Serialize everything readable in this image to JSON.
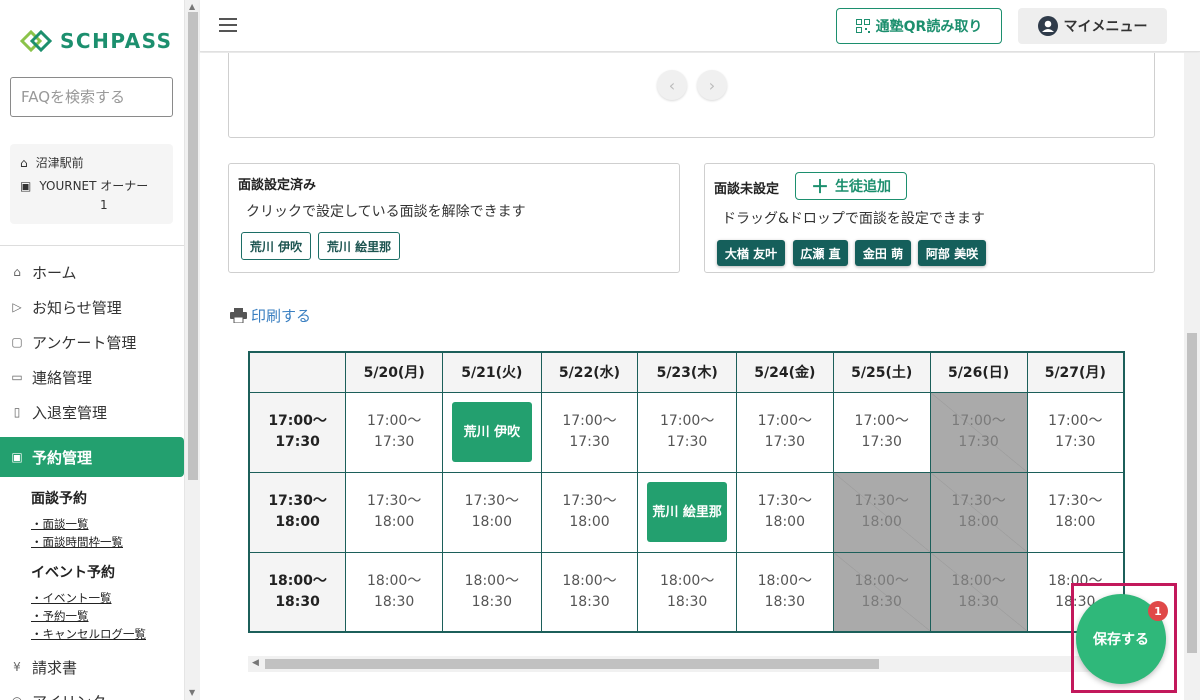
{
  "brand": {
    "name": "SCHPASS"
  },
  "search": {
    "placeholder": "FAQを検索する"
  },
  "org": {
    "school": "沼津駅前",
    "user": "YOURNET オーナー",
    "id": "1"
  },
  "sidebar": {
    "items": [
      {
        "label": "ホーム",
        "icon": "home-icon"
      },
      {
        "label": "お知らせ管理",
        "icon": "send-icon"
      },
      {
        "label": "アンケート管理",
        "icon": "survey-icon"
      },
      {
        "label": "連絡管理",
        "icon": "chat-icon"
      },
      {
        "label": "入退室管理",
        "icon": "door-icon"
      },
      {
        "label": "予約管理",
        "icon": "calendar-icon",
        "active": true
      }
    ],
    "sub": {
      "interview_heading": "面談予約",
      "interview_links": [
        "・面談一覧",
        "・面談時間枠一覧"
      ],
      "event_heading": "イベント予約",
      "event_links": [
        "・イベント一覧",
        "・予約一覧",
        "・キャンセルログ一覧"
      ]
    },
    "after": [
      {
        "label": "請求書",
        "icon": "yen-icon"
      },
      {
        "label": "アイリンク",
        "icon": "link-icon"
      }
    ]
  },
  "header": {
    "qr_label": "通塾QR読み取り",
    "mymenu_label": "マイメニュー"
  },
  "set_panel": {
    "title": "面談設定済み",
    "desc": "クリックで設定している面談を解除できます",
    "students": [
      "荒川 伊吹",
      "荒川 絵里那"
    ]
  },
  "unset_panel": {
    "title": "面談未設定",
    "add_label": "生徒追加",
    "desc": "ドラッグ&ドロップで面談を設定できます",
    "students": [
      "大楢 友叶",
      "広瀬 直",
      "金田 萌",
      "阿部 美咲"
    ]
  },
  "print_label": "印刷する",
  "calendar": {
    "dates": [
      "5/20(月)",
      "5/21(火)",
      "5/22(水)",
      "5/23(木)",
      "5/24(金)",
      "5/25(土)",
      "5/26(日)",
      "5/27(月)"
    ],
    "rows": [
      {
        "time": [
          "17:00〜",
          "17:30"
        ],
        "cells": [
          {
            "t": [
              "17:00〜",
              "17:30"
            ]
          },
          {
            "booked": "荒川 伊吹"
          },
          {
            "t": [
              "17:00〜",
              "17:30"
            ]
          },
          {
            "t": [
              "17:00〜",
              "17:30"
            ]
          },
          {
            "t": [
              "17:00〜",
              "17:30"
            ]
          },
          {
            "t": [
              "17:00〜",
              "17:30"
            ]
          },
          {
            "t": [
              "17:00〜",
              "17:30"
            ],
            "closed": true
          },
          {
            "t": [
              "17:00〜",
              "17:30"
            ]
          }
        ]
      },
      {
        "time": [
          "17:30〜",
          "18:00"
        ],
        "cells": [
          {
            "t": [
              "17:30〜",
              "18:00"
            ]
          },
          {
            "t": [
              "17:30〜",
              "18:00"
            ]
          },
          {
            "t": [
              "17:30〜",
              "18:00"
            ]
          },
          {
            "booked": "荒川 絵里那"
          },
          {
            "t": [
              "17:30〜",
              "18:00"
            ]
          },
          {
            "t": [
              "17:30〜",
              "18:00"
            ],
            "closed": true
          },
          {
            "t": [
              "17:30〜",
              "18:00"
            ],
            "closed": true
          },
          {
            "t": [
              "17:30〜",
              "18:00"
            ]
          }
        ]
      },
      {
        "time": [
          "18:00〜",
          "18:30"
        ],
        "cells": [
          {
            "t": [
              "18:00〜",
              "18:30"
            ]
          },
          {
            "t": [
              "18:00〜",
              "18:30"
            ]
          },
          {
            "t": [
              "18:00〜",
              "18:30"
            ]
          },
          {
            "t": [
              "18:00〜",
              "18:30"
            ]
          },
          {
            "t": [
              "18:00〜",
              "18:30"
            ]
          },
          {
            "t": [
              "18:00〜",
              "18:30"
            ],
            "closed": true
          },
          {
            "t": [
              "18:00〜",
              "18:30"
            ],
            "closed": true
          },
          {
            "t": [
              "18:00〜",
              "18:30"
            ]
          }
        ]
      }
    ]
  },
  "save": {
    "label": "保存する",
    "badge": "1"
  },
  "colors": {
    "brand": "#1c8f6e",
    "active": "#23a06f",
    "chip": "#155f5b",
    "save": "#2fb87a",
    "highlight": "#c2185b",
    "badge": "#e04848"
  }
}
